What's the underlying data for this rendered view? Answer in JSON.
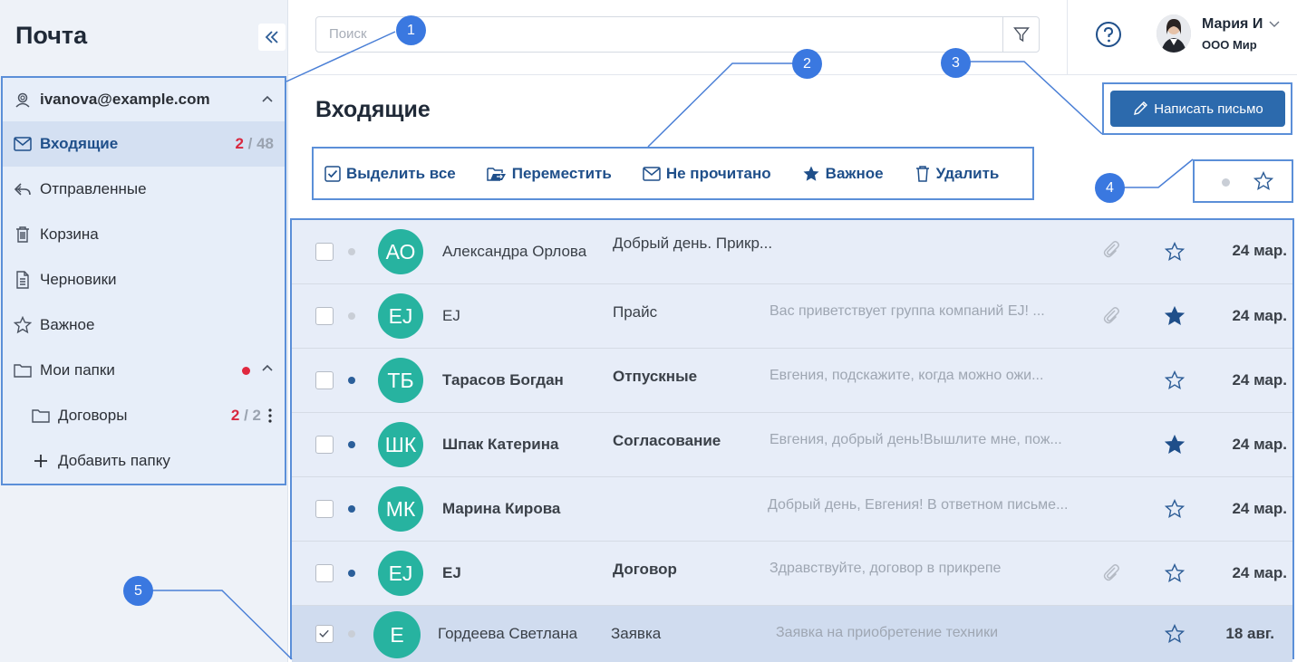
{
  "app": {
    "title": "Почта"
  },
  "sidebar": {
    "account": "ivanova@example.com",
    "items": [
      {
        "label": "Входящие",
        "unread": "2",
        "total": "48",
        "icon": "envelope-icon"
      },
      {
        "label": "Отправленные",
        "icon": "reply-icon"
      },
      {
        "label": "Корзина",
        "icon": "trash-icon"
      },
      {
        "label": "Черновики",
        "icon": "document-icon"
      },
      {
        "label": "Важное",
        "icon": "star-icon"
      },
      {
        "label": "Мои папки",
        "icon": "folder-icon"
      },
      {
        "label": "Договоры",
        "unread": "2",
        "total": "2",
        "icon": "folder-icon"
      },
      {
        "label": "Добавить папку",
        "icon": "plus-icon"
      }
    ]
  },
  "search": {
    "placeholder": "Поиск"
  },
  "user": {
    "name": "Мария И",
    "org": "ООО Мир"
  },
  "main": {
    "title": "Входящие",
    "compose_label": "Написать письмо",
    "toolbar": {
      "select_all": "Выделить все",
      "move": "Переместить",
      "unread": "Не прочитано",
      "important": "Важное",
      "delete": "Удалить"
    }
  },
  "mails": [
    {
      "initials": "АО",
      "sender": "Александра Орлова",
      "subject": "Добрый день. Прикр...",
      "preview": "",
      "date": "24 мар.",
      "unread": false,
      "starred": false,
      "attachment": true,
      "selected": false
    },
    {
      "initials": "EJ",
      "sender": "EJ",
      "subject": "Прайс",
      "preview": "Вас приветствует группа компаний EJ! ...",
      "date": "24 мар.",
      "unread": false,
      "starred": true,
      "attachment": true,
      "selected": false
    },
    {
      "initials": "ТБ",
      "sender": "Тарасов Богдан",
      "subject": "Отпускные",
      "preview": "Евгения, подскажите, когда можно ожи...",
      "date": "24 мар.",
      "unread": true,
      "starred": false,
      "attachment": false,
      "selected": false
    },
    {
      "initials": "ШК",
      "sender": "Шпак Катерина",
      "subject": "Согласование",
      "preview": "Евгения, добрый день!Вышлите мне, пож...",
      "date": "24 мар.",
      "unread": true,
      "starred": true,
      "attachment": false,
      "selected": false
    },
    {
      "initials": "МК",
      "sender": "Марина Кирова",
      "subject": "",
      "preview": "Добрый день, Евгения! В ответном письме...",
      "date": "24 мар.",
      "unread": true,
      "starred": false,
      "attachment": false,
      "selected": false
    },
    {
      "initials": "EJ",
      "sender": "EJ",
      "subject": "Договор",
      "preview": "Здравствуйте, договор в прикрепе",
      "date": "24 мар.",
      "unread": true,
      "starred": false,
      "attachment": true,
      "selected": false
    },
    {
      "initials": "Е",
      "sender": "Гордеева Светлана",
      "subject": "Заявка",
      "preview": "Заявка на приобретение техники",
      "date": "18 авг.",
      "unread": false,
      "starred": false,
      "attachment": false,
      "selected": true
    }
  ],
  "callouts": [
    "1",
    "2",
    "3",
    "4",
    "5"
  ],
  "colors": {
    "accent": "#2c6aad",
    "avatar": "#27b3a0",
    "unread_count": "#d8283f",
    "callout": "#3a78e0"
  }
}
